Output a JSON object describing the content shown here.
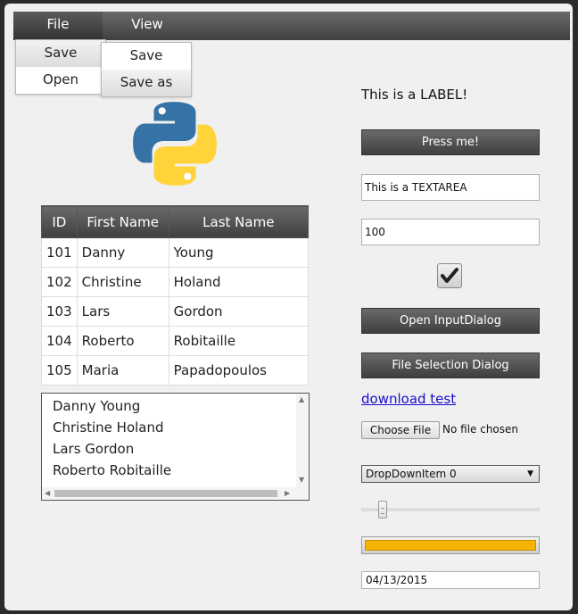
{
  "menu": {
    "file": {
      "label": "File",
      "items": [
        "Save",
        "Open"
      ]
    },
    "view": {
      "label": "View",
      "items": [
        "Save",
        "Save as"
      ]
    }
  },
  "logo": {
    "icon": "python-logo-icon"
  },
  "table": {
    "headers": [
      "ID",
      "First Name",
      "Last Name"
    ],
    "rows": [
      [
        "101",
        "Danny",
        "Young"
      ],
      [
        "102",
        "Christine",
        "Holand"
      ],
      [
        "103",
        "Lars",
        "Gordon"
      ],
      [
        "104",
        "Roberto",
        "Robitaille"
      ],
      [
        "105",
        "Maria",
        "Papadopoulos"
      ]
    ]
  },
  "listbox": {
    "items": [
      "Danny Young",
      "Christine Holand",
      "Lars Gordon",
      "Roberto Robitaille"
    ]
  },
  "form": {
    "label": "This is a LABEL!",
    "press_button": "Press me!",
    "textarea_value": "This is a TEXTAREA",
    "number_value": "100",
    "checkbox_checked": true,
    "input_dialog_button": "Open InputDialog",
    "file_selection_button": "File Selection Dialog",
    "link_text": "download test",
    "choose_file_button": "Choose File",
    "no_file_text": "No file chosen",
    "dropdown_selected": "DropDownItem 0",
    "slider_value": 0.12,
    "progress_value": 1.0,
    "date_value": "04/13/2015"
  },
  "colors": {
    "menubar": "#4f4f4f",
    "window_bg": "#f0f0f0",
    "link": "#1a0dcc",
    "progress_fill": "#f4b400",
    "python_blue": "#3572a5",
    "python_yellow": "#ffd43b"
  }
}
